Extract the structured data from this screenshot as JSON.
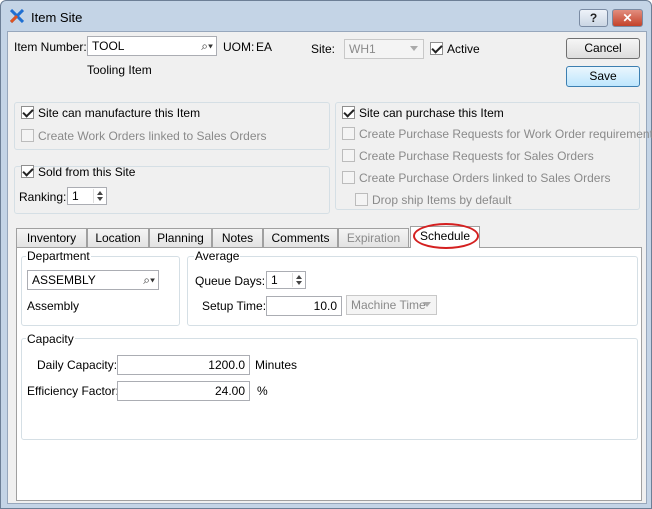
{
  "window": {
    "title": "Item Site",
    "help_label": "?",
    "close_label": "✕",
    "icon": "x-logo-icon"
  },
  "header": {
    "item_number_label": "Item Number:",
    "item_number_value": "TOOL",
    "item_description": "Tooling Item",
    "uom_label": "UOM:",
    "uom_value": "EA",
    "site_label": "Site:",
    "site_value": "WH1",
    "active_label": "Active",
    "active_checked": true
  },
  "buttons": {
    "cancel": "Cancel",
    "save": "Save"
  },
  "manufacture": {
    "can_manufacture_label": "Site can manufacture this Item",
    "create_wo_label": "Create Work Orders linked to Sales Orders"
  },
  "sold": {
    "sold_label": "Sold from this Site",
    "ranking_label": "Ranking:",
    "ranking_value": "1"
  },
  "purchase": {
    "can_purchase_label": "Site can purchase this Item",
    "pr_wo_label": "Create Purchase Requests for Work Order requirements",
    "pr_so_label": "Create Purchase Requests for Sales Orders",
    "po_so_label": "Create Purchase Orders linked to Sales Orders",
    "drop_ship_label": "Drop ship Items by default"
  },
  "tabs": [
    {
      "label": "Inventory"
    },
    {
      "label": "Location"
    },
    {
      "label": "Planning"
    },
    {
      "label": "Notes"
    },
    {
      "label": "Comments"
    },
    {
      "label": "Expiration"
    },
    {
      "label": "Schedule"
    }
  ],
  "schedule": {
    "department": {
      "title": "Department",
      "value": "ASSEMBLY",
      "description": "Assembly"
    },
    "average": {
      "title": "Average",
      "queue_days_label": "Queue Days:",
      "queue_days_value": "1",
      "setup_time_label": "Setup Time:",
      "setup_time_value": "10.0",
      "setup_unit_value": "Machine Time"
    },
    "capacity": {
      "title": "Capacity",
      "daily_capacity_label": "Daily Capacity:",
      "daily_capacity_value": "1200.0",
      "daily_capacity_unit": "Minutes",
      "efficiency_label": "Efficiency Factor:",
      "efficiency_value": "24.00",
      "efficiency_unit": "%"
    }
  }
}
